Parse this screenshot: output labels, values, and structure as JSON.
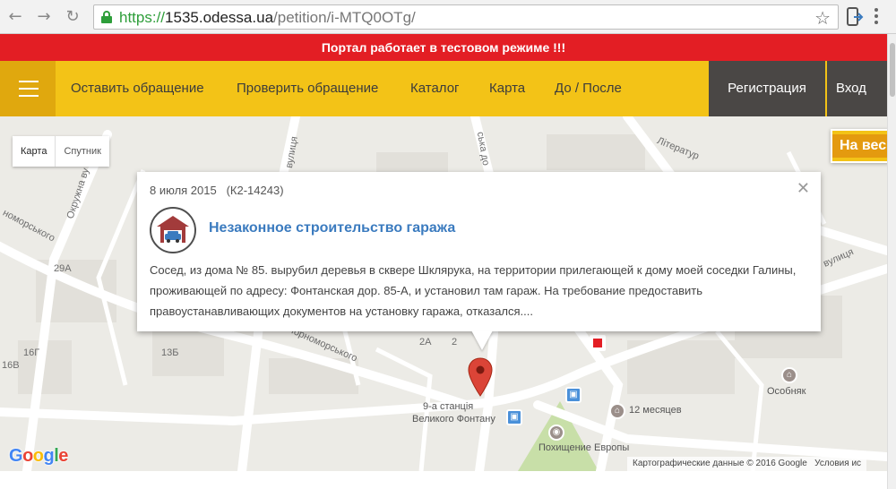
{
  "browser": {
    "url_scheme": "https://",
    "url_host": "1535.odessa.ua",
    "url_path": "/petition/i-MTQ0OTg/"
  },
  "site": {
    "banner": "Портал работает в тестовом режиме !!!",
    "nav": [
      "Оставить обращение",
      "Проверить обращение",
      "Каталог",
      "Карта",
      "До / После"
    ],
    "register": "Регистрация",
    "login": "Вход",
    "view_button": "На вес"
  },
  "map": {
    "type_map": "Карта",
    "type_satellite": "Спутник",
    "labels": {
      "okruzhna": "Окружна ву",
      "vulytsia1": "вулиця",
      "dovzh": "ська до",
      "literaturna": "Літератур",
      "nomorskoho": "номорського",
      "chornomorskoho": "Чорноморського",
      "vulytsia2": "вулиця",
      "n29a": "29А",
      "n16b": "16В",
      "n16g": "16Г",
      "n13b": "13Б",
      "n2a": "2А",
      "n2": "2"
    },
    "pois": {
      "station1": "9-а станція",
      "station2": "Великого Фонтану",
      "months": "12 месяцев",
      "osobnyak": "Особняк",
      "europe": "Похищение Европы"
    },
    "attribution": "Картографические данные © 2016 Google",
    "terms": "Условия ис",
    "logo": "Google"
  },
  "info_window": {
    "date": "8 июля 2015",
    "code": "(К2-14243)",
    "title": "Незаконное строительство гаража",
    "text": "Сосед, из дома № 85. вырубил деревья в сквере Шклярука, на территории прилегающей к дому моей соседки Галины, проживающей по адресу: Фонтанская дор. 85-А, и установил там гараж. На требование предоставить правоустанавливающих документов на установку гаража, отказался...."
  },
  "colors": {
    "banner": "#e31e24",
    "nav": "#f3c317",
    "nav_dark": "#4a4745",
    "title": "#3b7bbf",
    "pin": "#db4437"
  }
}
